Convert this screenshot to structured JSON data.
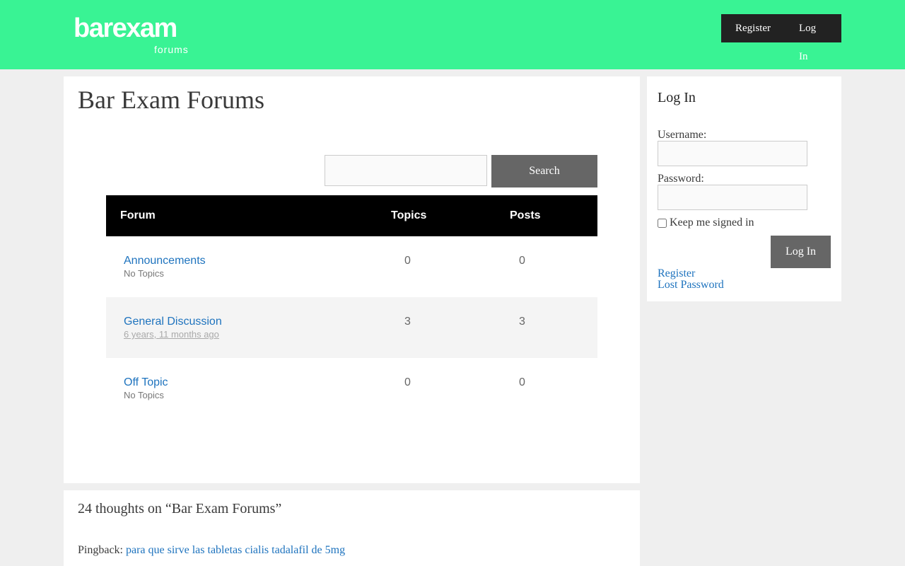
{
  "header": {
    "logo_main": "barexam",
    "logo_sub": "forums",
    "nav": {
      "register": "Register",
      "login": "Log In"
    }
  },
  "main": {
    "title": "Bar Exam Forums",
    "search": {
      "value": "",
      "button": "Search"
    },
    "table": {
      "headers": {
        "forum": "Forum",
        "topics": "Topics",
        "posts": "Posts"
      },
      "rows": [
        {
          "title": "Announcements",
          "sub": "No Topics",
          "topics": "0",
          "posts": "0"
        },
        {
          "title": "General Discussion",
          "sub": "6 years, 11 months ago",
          "topics": "3",
          "posts": "3"
        },
        {
          "title": "Off Topic",
          "sub": "No Topics",
          "topics": "0",
          "posts": "0"
        }
      ]
    }
  },
  "comments": {
    "title": "24 thoughts on “Bar Exam Forums”",
    "pingback_label": "Pingback:",
    "pingback_link": "para que sirve las tabletas cialis tadalafil de 5mg"
  },
  "sidebar": {
    "title": "Log In",
    "username_label": "Username:",
    "password_label": "Password:",
    "remember_label": "Keep me signed in",
    "login_button": "Log In",
    "register_link": "Register",
    "lost_password_link": "Lost Password"
  },
  "colors": {
    "header_bg": "#39f394",
    "link": "#1e73be",
    "button": "#666666",
    "nav_bg": "#222222"
  }
}
